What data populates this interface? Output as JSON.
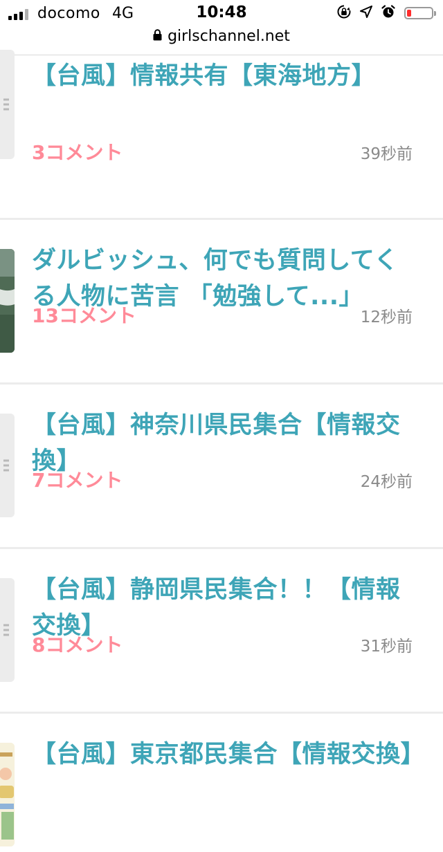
{
  "status_bar": {
    "carrier": "docomo",
    "network": "4G",
    "time": "10:48",
    "battery_level": 0.18,
    "battery_color": "#ff2d2d",
    "icons": [
      "signal-icon",
      "orientation-lock-icon",
      "location-icon",
      "alarm-icon",
      "battery-icon"
    ]
  },
  "browser": {
    "domain": "girlschannel.net",
    "secure_icon": "lock-icon"
  },
  "feed": {
    "items": [
      {
        "title": "【台風】情報共有【東海地方】",
        "comments": "3コメント",
        "time": "39秒前",
        "thumbnail": "placeholder"
      },
      {
        "title": "ダルビッシュ、何でも質問してくる人物に苦言 「勉強して...」",
        "comments": "13コメント",
        "time": "12秒前",
        "thumbnail": "photo"
      },
      {
        "title": "【台風】神奈川県民集合【情報交換】",
        "comments": "7コメント",
        "time": "24秒前",
        "thumbnail": "placeholder"
      },
      {
        "title": "【台風】静岡県民集合！！【情報交換】",
        "comments": "8コメント",
        "time": "31秒前",
        "thumbnail": "placeholder"
      },
      {
        "title": "【台風】東京都民集合【情報交換】",
        "comments": "",
        "time": "",
        "thumbnail": "illustration"
      }
    ]
  },
  "colors": {
    "title": "#3ea5b7",
    "comments": "#ff8a98",
    "time": "#8a8a8a",
    "divider": "#ececec"
  }
}
